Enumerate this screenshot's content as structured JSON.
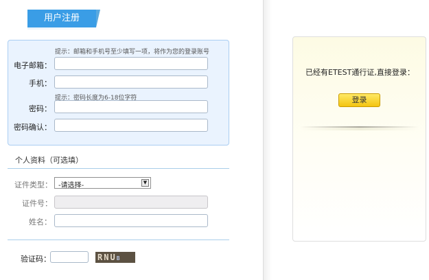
{
  "register": {
    "title": "用户注册",
    "email_hint": "提示：邮箱和手机号至少填写一项，将作为您的登录账号",
    "email_label": "电子邮箱：",
    "phone_label": "手机：",
    "password_hint": "提示：密码长度为6-18位字符",
    "password_label": "密码：",
    "confirm_label": "密码确认："
  },
  "profile": {
    "section_title": "个人资料（可选填）",
    "id_type_label": "证件类型：",
    "id_type_selected": "-请选择-",
    "id_number_label": "证件号：",
    "name_label": "姓名："
  },
  "captcha": {
    "label": "验证码：",
    "main_text": "RNU",
    "small_text": "B"
  },
  "login": {
    "prompt": "已经有ETEST通行证,直接登录：",
    "button_label": "登录"
  },
  "colors": {
    "accent": "#3a9de6",
    "panel_bg": "#eaf3fe",
    "login_button": "#f3c410"
  }
}
